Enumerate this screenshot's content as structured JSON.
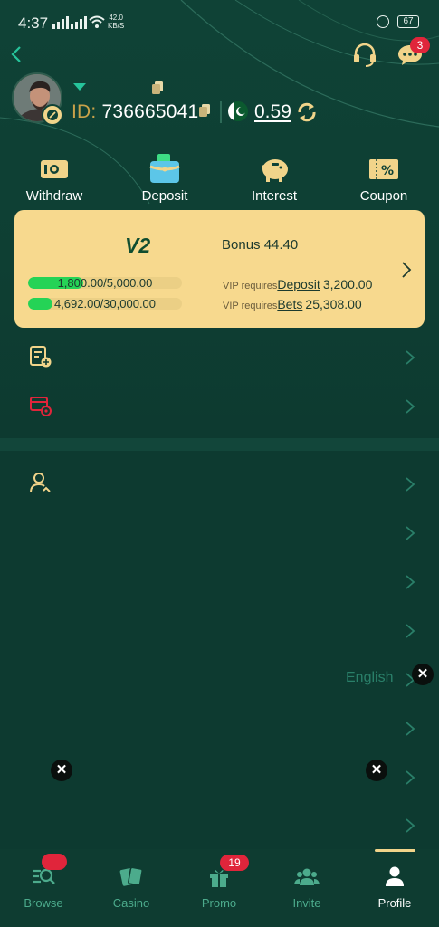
{
  "status_bar": {
    "time": "4:37",
    "net_speed_value": "42.0",
    "net_speed_unit": "KB/S",
    "battery": "67"
  },
  "header": {
    "chat_badge": "3"
  },
  "profile": {
    "id_label": "ID:",
    "id_value": "736665041",
    "balance": "0.59"
  },
  "quick_actions": [
    {
      "label": "Withdraw",
      "icon": "withdraw-icon"
    },
    {
      "label": "Deposit",
      "icon": "wallet-icon"
    },
    {
      "label": "Interest",
      "icon": "piggy-bank-icon"
    },
    {
      "label": "Coupon",
      "icon": "coupon-icon"
    }
  ],
  "vip": {
    "level": "V2",
    "bonus": "Bonus 44.40",
    "deposit_progress": {
      "text": "1,800.00/5,000.00",
      "fraction": 0.36
    },
    "bets_progress": {
      "text": "4,692.00/30,000.00",
      "fraction": 0.156
    },
    "deposit_req_prefix": "VIP requires",
    "deposit_req_link": "Deposit",
    "deposit_req_amount": "3,200.00",
    "bets_req_prefix": "VIP requires",
    "bets_req_link": "Bets",
    "bets_req_amount": "25,308.00"
  },
  "settings": {
    "language_value": "English"
  },
  "nav": {
    "items": [
      {
        "label": "Browse",
        "icon": "browse-icon"
      },
      {
        "label": "Casino",
        "icon": "cards-icon"
      },
      {
        "label": "Promo",
        "icon": "gift-icon"
      },
      {
        "label": "Invite",
        "icon": "people-icon"
      },
      {
        "label": "Profile",
        "icon": "person-icon"
      }
    ],
    "promo_badge": "19",
    "active": "Profile"
  },
  "colors": {
    "background": "#0d3a30",
    "vip_card": "#f7d98e",
    "accent_gold": "#f1d48a",
    "badge_red": "#e0253b",
    "progress_green": "#25d356"
  }
}
